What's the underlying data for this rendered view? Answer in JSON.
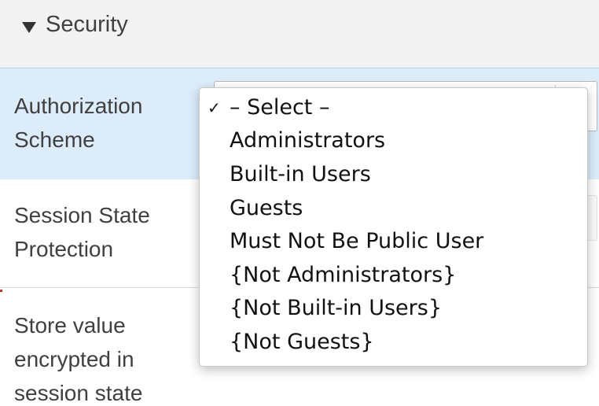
{
  "section": {
    "title": "Security"
  },
  "rows": [
    {
      "label": "Authorization\nScheme"
    },
    {
      "label": "Session State\nProtection"
    },
    {
      "label": "Store value\nencrypted in\nsession state"
    }
  ],
  "dropdown": {
    "check_glyph": "✓",
    "selected_index": 0,
    "options": [
      "– Select –",
      "Administrators",
      "Built-in Users",
      "Guests",
      "Must Not Be Public User",
      "{Not Administrators}",
      "{Not Built-in Users}",
      "{Not Guests}"
    ]
  },
  "colors": {
    "highlight_row": "#dcecfa",
    "header_bg": "#f2f2f2",
    "text": "#404040"
  }
}
